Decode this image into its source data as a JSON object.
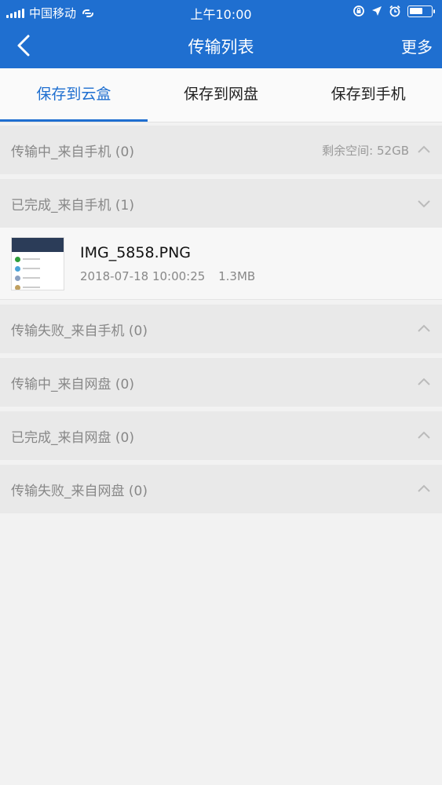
{
  "status_bar": {
    "carrier": "中国移动",
    "time": "上午10:00"
  },
  "nav": {
    "title": "传输列表",
    "more_label": "更多"
  },
  "tabs": [
    {
      "label": "保存到云盒",
      "active": true
    },
    {
      "label": "保存到网盘",
      "active": false
    },
    {
      "label": "保存到手机",
      "active": false
    }
  ],
  "sections": [
    {
      "title": "传输中_来自手机 (0)",
      "extra": "剩余空间: 52GB",
      "expanded": true
    },
    {
      "title": "已完成_来自手机 (1)",
      "expanded": false
    },
    {
      "title": "传输失败_来自手机 (0)",
      "expanded": true
    },
    {
      "title": "传输中_来自网盘 (0)",
      "expanded": true
    },
    {
      "title": "已完成_来自网盘 (0)",
      "expanded": true
    },
    {
      "title": "传输失败_来自网盘 (0)",
      "expanded": true
    }
  ],
  "file": {
    "name": "IMG_5858.PNG",
    "date": "2018-07-18 10:00:25",
    "size": "1.3MB"
  },
  "colors": {
    "accent": "#1f6fd0"
  }
}
